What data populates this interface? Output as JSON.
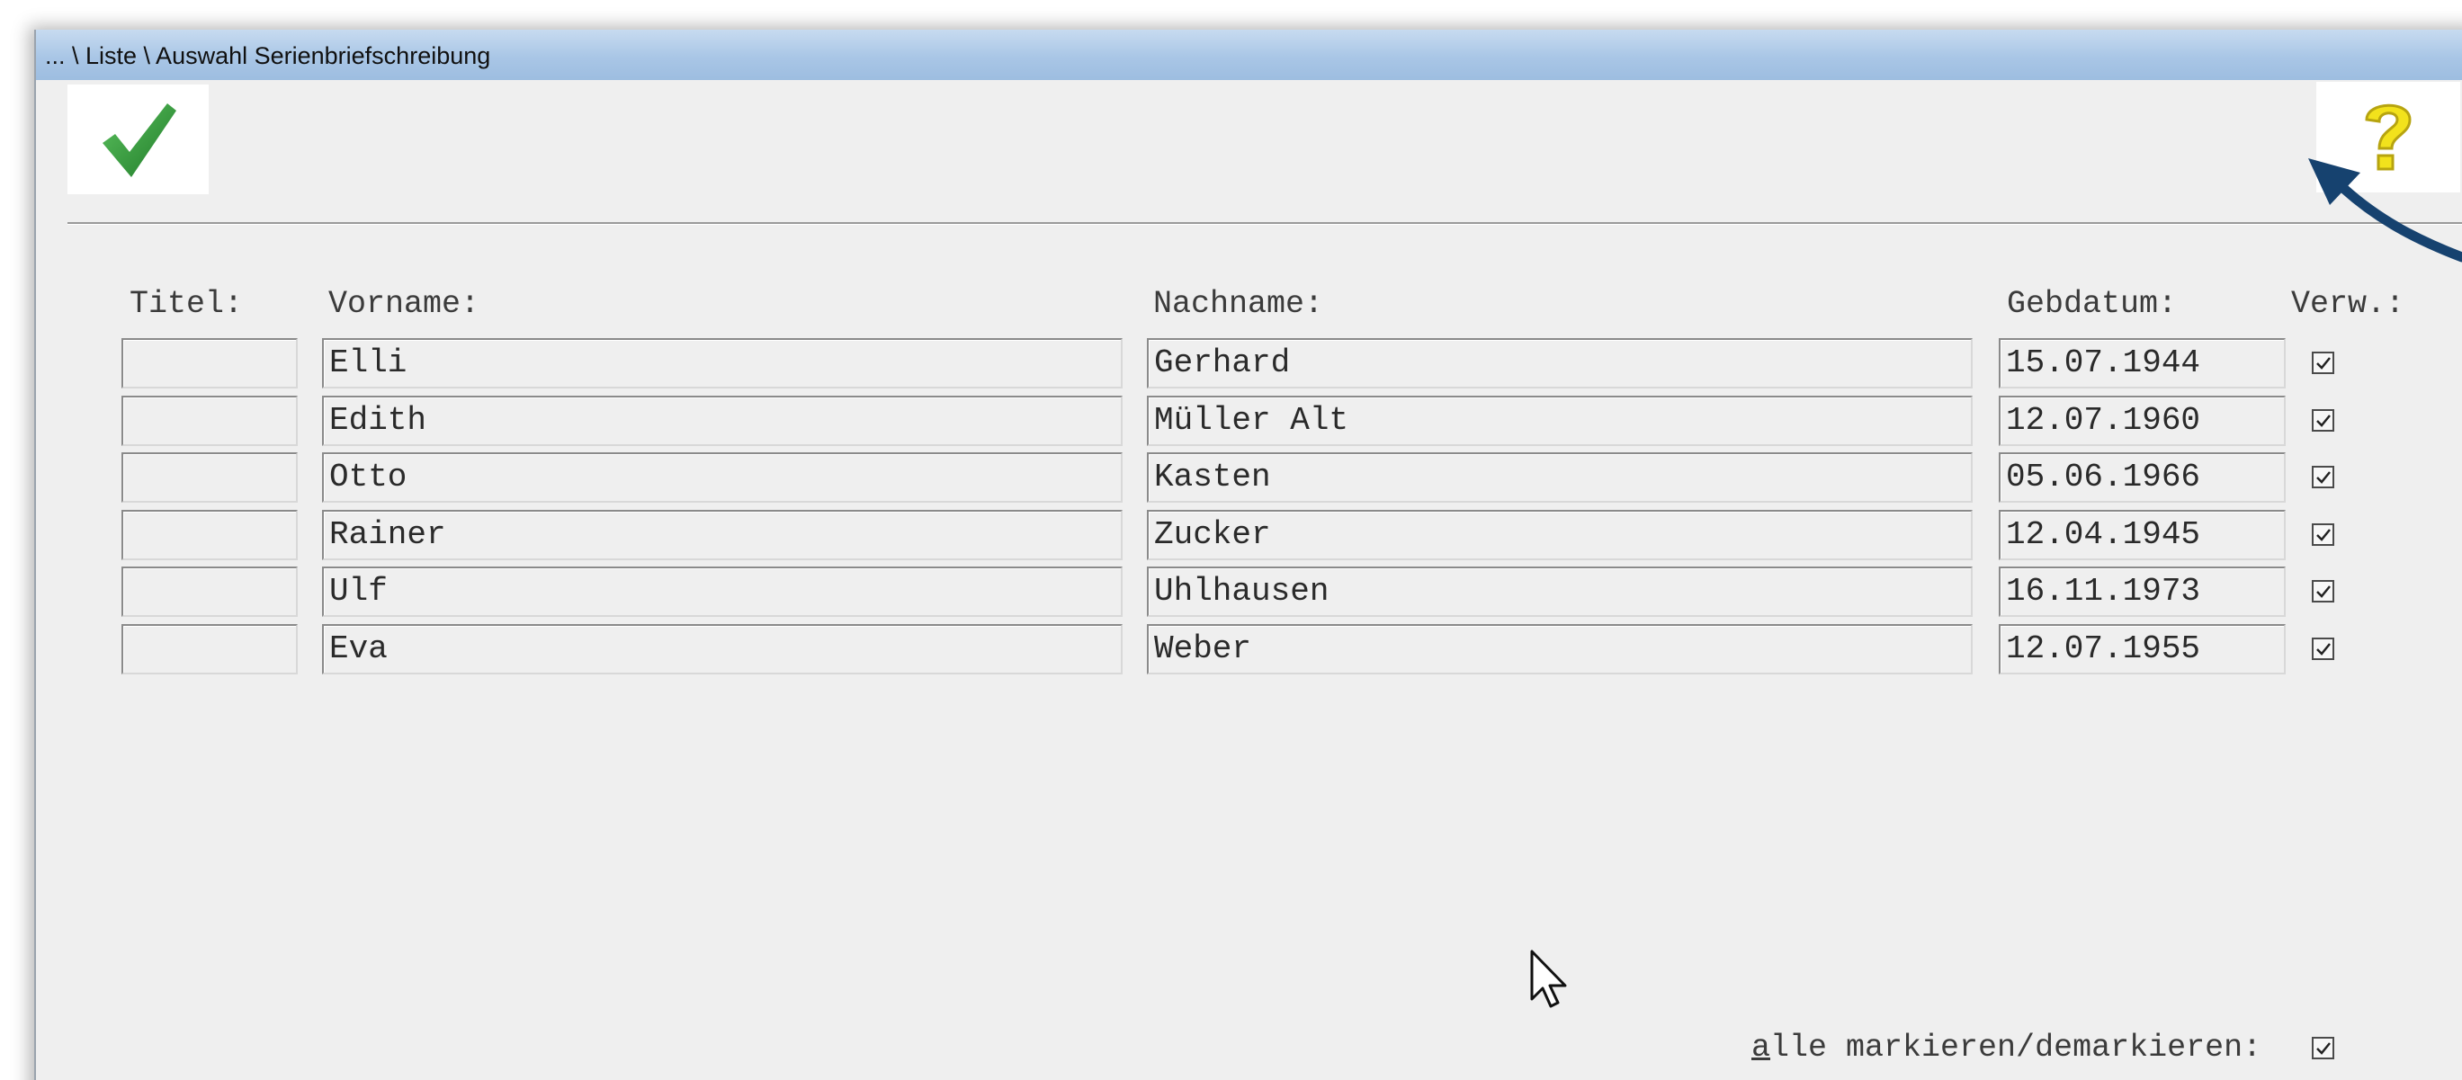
{
  "window": {
    "title": "... \\ Liste \\ Auswahl Serienbriefschreibung"
  },
  "toolbar": {
    "ok_icon": "green-checkmark-icon",
    "help_icon": "yellow-question-mark-icon"
  },
  "table": {
    "headers": {
      "titel": "Titel:",
      "vorname": "Vorname:",
      "nachname": "Nachname:",
      "gebdatum": "Gebdatum:",
      "verw": "Verw.:"
    },
    "rows": [
      {
        "titel": "",
        "vorname": "Elli",
        "nachname": "Gerhard",
        "gebdatum": "15.07.1944",
        "verw": true
      },
      {
        "titel": "",
        "vorname": "Edith",
        "nachname": "Müller Alt",
        "gebdatum": "12.07.1960",
        "verw": true
      },
      {
        "titel": "",
        "vorname": "Otto",
        "nachname": "Kasten",
        "gebdatum": "05.06.1966",
        "verw": true
      },
      {
        "titel": "",
        "vorname": "Rainer",
        "nachname": "Zucker",
        "gebdatum": "12.04.1945",
        "verw": true
      },
      {
        "titel": "",
        "vorname": "Ulf",
        "nachname": "Uhlhausen",
        "gebdatum": "16.11.1973",
        "verw": true
      },
      {
        "titel": "",
        "vorname": "Eva",
        "nachname": "Weber",
        "gebdatum": "12.07.1955",
        "verw": true
      }
    ]
  },
  "footer": {
    "select_all_mnemonic": "a",
    "select_all_rest": "lle markieren/demarkieren:",
    "select_all_checked": true
  },
  "colors": {
    "titlebar": "#a9c6e6",
    "window_bg": "#efefef",
    "check_green": "#2e9a35",
    "help_yellow": "#f2e21c",
    "annotation_arrow": "#16426f"
  }
}
